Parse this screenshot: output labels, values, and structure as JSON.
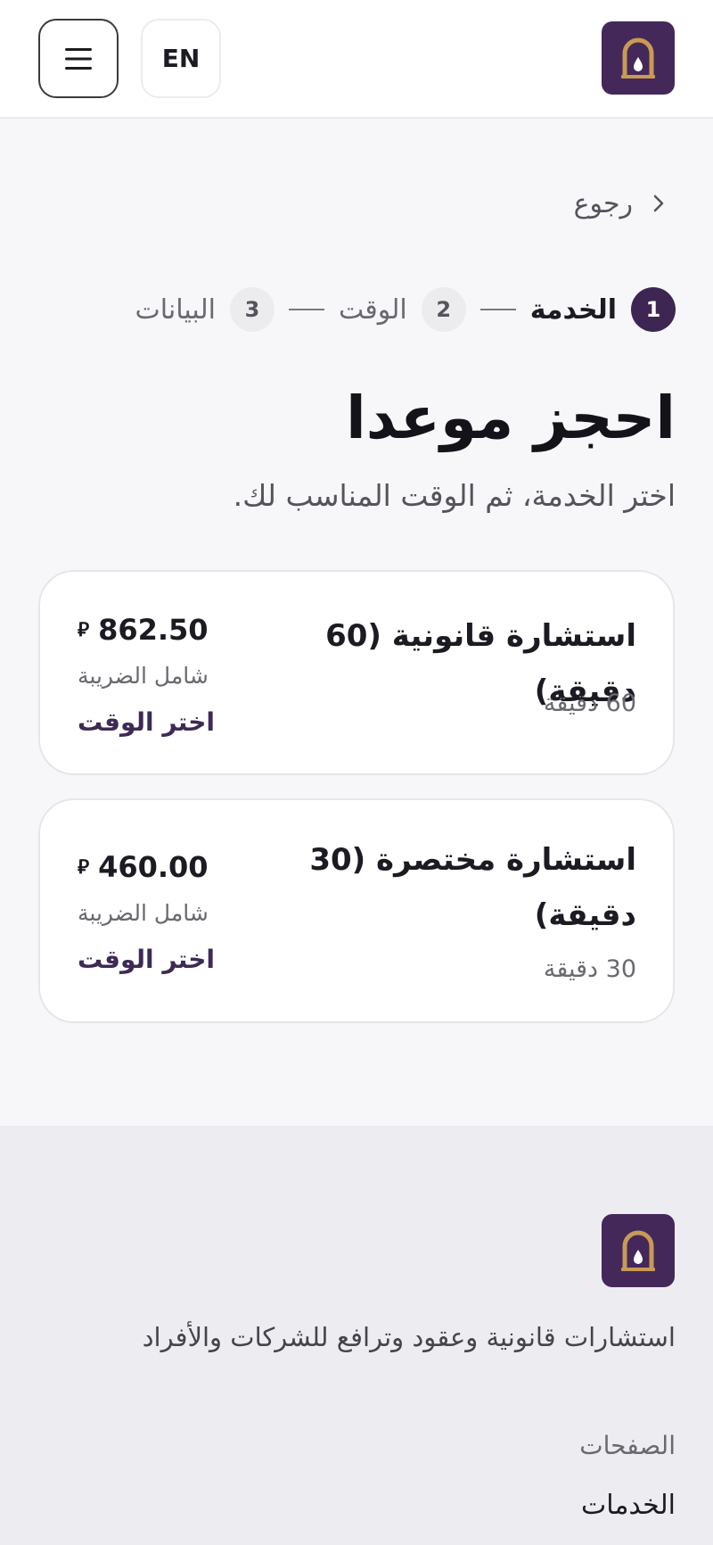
{
  "header": {
    "lang_label": "EN",
    "menu_icon": "hamburger-menu-icon",
    "logo_icon": "arch-lantern-logo-icon",
    "brand_color": "#45285a"
  },
  "back": {
    "label": "رجوع",
    "icon": "chevron-right-icon"
  },
  "steps": [
    {
      "number": "1",
      "label": "الخدمة",
      "active": true
    },
    {
      "number": "2",
      "label": "الوقت",
      "active": false
    },
    {
      "number": "3",
      "label": "البيانات",
      "active": false
    }
  ],
  "page": {
    "title": "احجز موعدا",
    "subtitle": "اختر الخدمة، ثم الوقت المناسب لك."
  },
  "services": [
    {
      "title": "استشارة قانونية (60 دقيقة)",
      "duration": "60 دقيقة",
      "price": "862.50",
      "currency_symbol": "⃁",
      "tax_note": "شامل الضريبة",
      "action_label": "اختر الوقت"
    },
    {
      "title": "استشارة مختصرة (30 دقيقة)",
      "duration": "30 دقيقة",
      "price": "460.00",
      "currency_symbol": "⃁",
      "tax_note": "شامل الضريبة",
      "action_label": "اختر الوقت"
    }
  ],
  "footer": {
    "tagline": "استشارات قانونية وعقود وترافع للشركات والأفراد",
    "pages_heading": "الصفحات",
    "links": [
      "الخدمات"
    ]
  }
}
